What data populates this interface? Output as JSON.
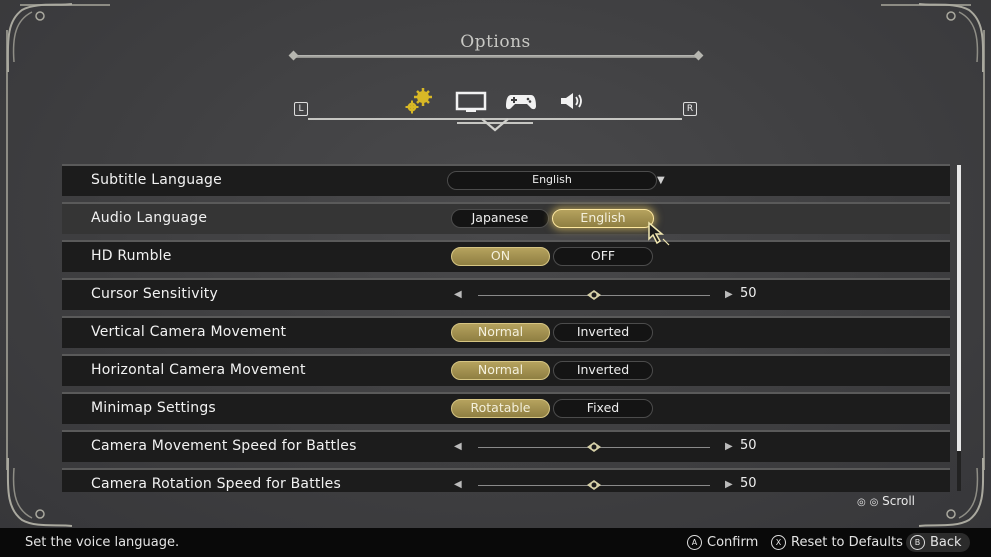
{
  "header": {
    "title": "Options",
    "shoulder_left": "L",
    "shoulder_right": "R"
  },
  "tabs": [
    {
      "name": "general",
      "icon": "gears-icon",
      "active": true
    },
    {
      "name": "display",
      "icon": "monitor-icon",
      "active": false
    },
    {
      "name": "controls",
      "icon": "gamepad-icon",
      "active": false
    },
    {
      "name": "sound",
      "icon": "speaker-icon",
      "active": false
    }
  ],
  "colors": {
    "accent_gold": "#b5a25e",
    "row_bg": "#1c1c1c",
    "row_selected_bg": "#353535",
    "background": "#3f3f40"
  },
  "settings": [
    {
      "label": "Subtitle Language",
      "type": "dropdown",
      "value": "English"
    },
    {
      "label": "Audio Language",
      "type": "toggle",
      "options": [
        "Japanese",
        "English"
      ],
      "selected": "English"
    },
    {
      "label": "HD Rumble",
      "type": "toggle",
      "options": [
        "ON",
        "OFF"
      ],
      "selected": "ON"
    },
    {
      "label": "Cursor Sensitivity",
      "type": "slider",
      "value": "50"
    },
    {
      "label": "Vertical Camera Movement",
      "type": "toggle",
      "options": [
        "Normal",
        "Inverted"
      ],
      "selected": "Normal"
    },
    {
      "label": "Horizontal Camera Movement",
      "type": "toggle",
      "options": [
        "Normal",
        "Inverted"
      ],
      "selected": "Normal"
    },
    {
      "label": "Minimap Settings",
      "type": "toggle",
      "options": [
        "Rotatable",
        "Fixed"
      ],
      "selected": "Rotatable"
    },
    {
      "label": "Camera Movement Speed for Battles",
      "type": "slider",
      "value": "50"
    },
    {
      "label": "Camera Rotation Speed for Battles",
      "type": "slider",
      "value": "50"
    }
  ],
  "scroll_hint": "Scroll",
  "footer": {
    "help_text": "Set the voice language.",
    "confirm": {
      "glyph": "A",
      "label": "Confirm"
    },
    "reset": {
      "glyph": "X",
      "label": "Reset to Defaults"
    },
    "back": {
      "glyph": "B",
      "label": "Back"
    }
  }
}
